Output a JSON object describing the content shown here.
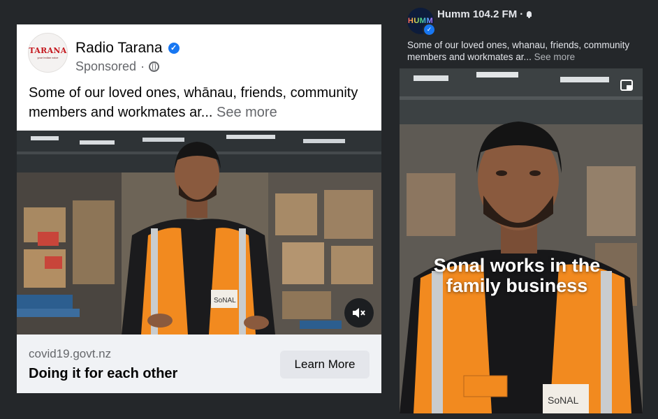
{
  "left_ad": {
    "logo_text": "TARANA",
    "logo_subtext": "your indian voice",
    "page_name": "Radio Tarana",
    "sponsored_label": "Sponsored",
    "dot": "·",
    "caption": "Some of our loved ones, whānau, friends, community members and workmates ar...",
    "see_more": "See more",
    "vest_nametag": "SoNAL",
    "footer": {
      "domain": "covid19.govt.nz",
      "headline": "Doing it for each other",
      "cta_label": "Learn More"
    }
  },
  "right_post": {
    "avatar_text": "HUMM",
    "page_name": "Humm 104.2  FM",
    "dot": "·",
    "caption": "Some of our loved ones, whanau, friends, community members and workmates ar...",
    "see_more": "See more",
    "overlay_line1": "Sonal works in the",
    "overlay_line2": "family business",
    "vest_nametag": "SoNAL"
  },
  "colors": {
    "background": "#24272a",
    "verified_blue": "#1877f2",
    "vest_orange": "#f28a1f",
    "footer_bg": "#f0f2f5"
  },
  "icons": [
    "verified-badge-icon",
    "globe-icon",
    "mute-icon",
    "bell-icon",
    "picture-in-picture-icon"
  ]
}
